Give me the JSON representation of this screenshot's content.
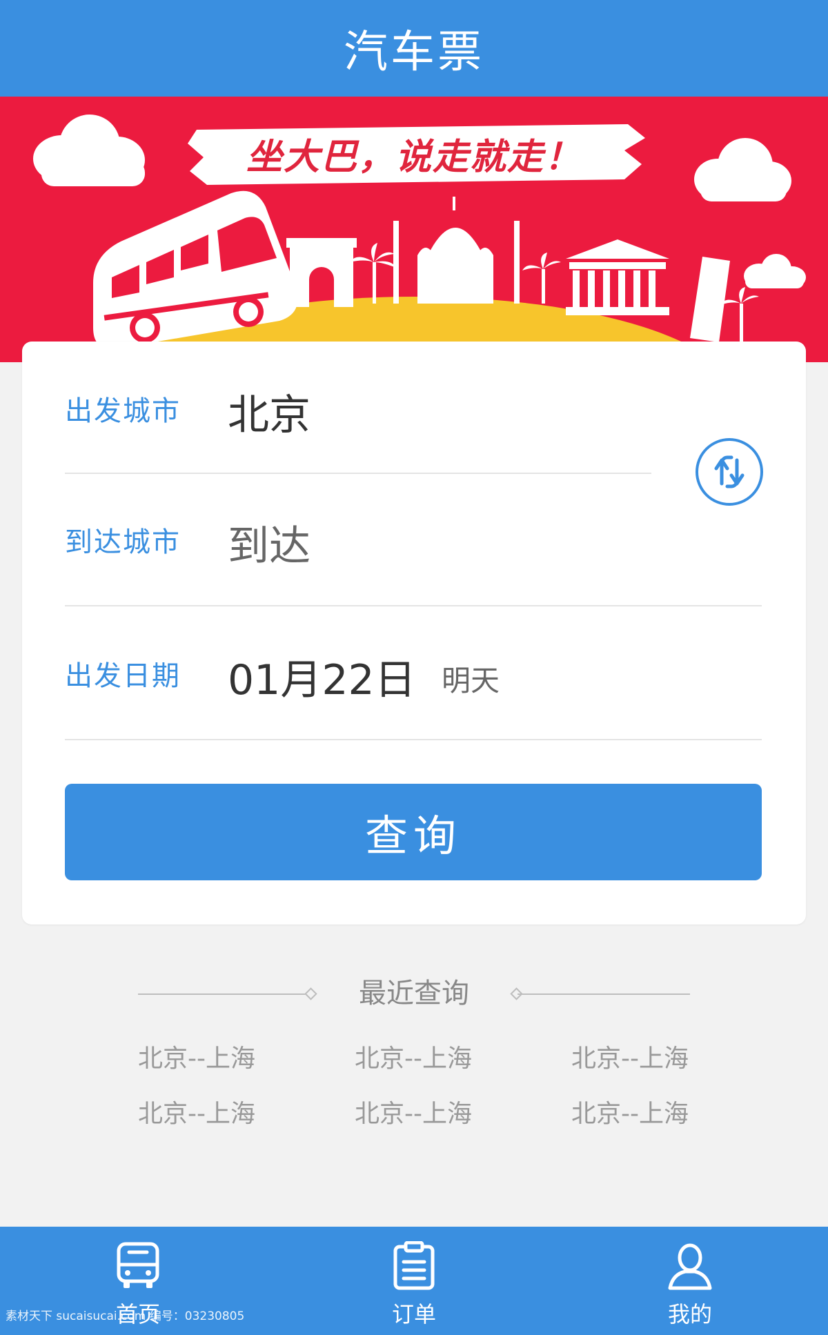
{
  "header": {
    "title": "汽车票"
  },
  "banner": {
    "slogan": "坐大巴，说走就走！"
  },
  "form": {
    "departure": {
      "label": "出发城市",
      "value": "北京"
    },
    "arrival": {
      "label": "到达城市",
      "placeholder": "到达"
    },
    "date": {
      "label": "出发日期",
      "value": "01月22日",
      "note": "明天"
    },
    "swap_icon": "swap-icon",
    "query_button": "查询"
  },
  "recent": {
    "title": "最近查询",
    "items": [
      "北京--上海",
      "北京--上海",
      "北京--上海",
      "北京--上海",
      "北京--上海",
      "北京--上海"
    ]
  },
  "bottom_nav": [
    {
      "label": "首页",
      "icon": "bus-icon"
    },
    {
      "label": "订单",
      "icon": "clipboard-icon"
    },
    {
      "label": "我的",
      "icon": "user-icon"
    }
  ],
  "watermark": "素材天下 sucaisucai.com  编号：03230805",
  "colors": {
    "primary": "#3a8fe0",
    "banner": "#ec1b3f",
    "hill": "#f7c52c"
  }
}
